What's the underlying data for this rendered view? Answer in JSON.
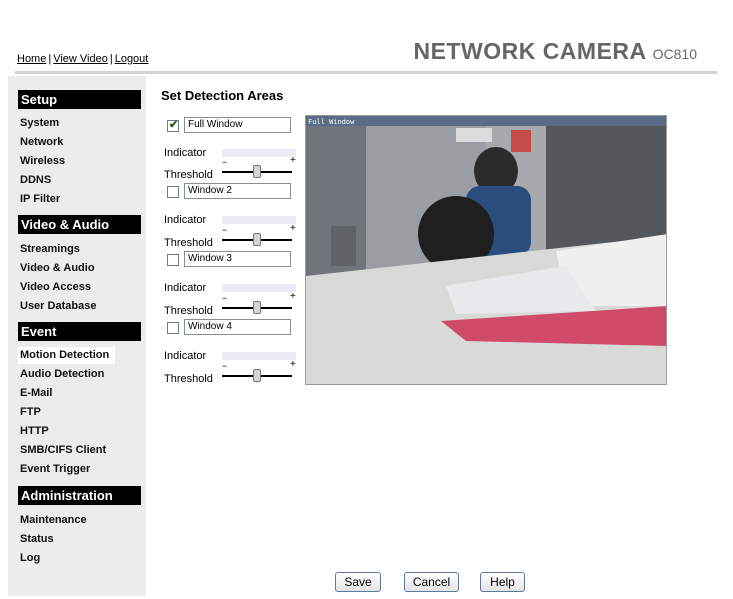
{
  "header": {
    "nav": [
      "Home",
      "View Video",
      "Logout"
    ],
    "brand": "NETWORK CAMERA",
    "model": "OC810"
  },
  "sidebar": {
    "sections": [
      {
        "title": "Setup",
        "items": [
          "System",
          "Network",
          "Wireless",
          "DDNS",
          "IP Filter"
        ]
      },
      {
        "title": "Video & Audio",
        "items": [
          "Streamings",
          "Video & Audio",
          "Video Access",
          "User Database"
        ]
      },
      {
        "title": "Event",
        "items": [
          "Motion Detection",
          "Audio Detection",
          "E-Mail",
          "FTP",
          "HTTP",
          "SMB/CIFS Client",
          "Event Trigger"
        ]
      },
      {
        "title": "Administration",
        "items": [
          "Maintenance",
          "Status",
          "Log"
        ]
      }
    ],
    "active_item": "Motion Detection"
  },
  "main": {
    "title": "Set Detection Areas",
    "indicator_label": "Indicator",
    "threshold_label": "Threshold",
    "windows": [
      {
        "name": "Full Window",
        "checked": true,
        "threshold": 0.5
      },
      {
        "name": "Window 2",
        "checked": false,
        "threshold": 0.5
      },
      {
        "name": "Window 3",
        "checked": false,
        "threshold": 0.5
      },
      {
        "name": "Window 4",
        "checked": false,
        "threshold": 0.5
      }
    ],
    "camera_overlay_label": "Full Window"
  },
  "buttons": {
    "save": "Save",
    "cancel": "Cancel",
    "help": "Help"
  }
}
